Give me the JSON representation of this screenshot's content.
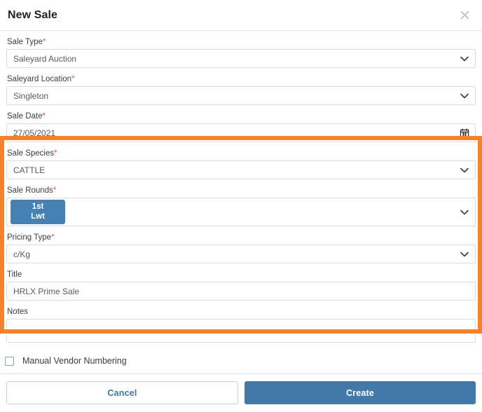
{
  "dialog": {
    "title": "New Sale",
    "close_icon": "close-icon"
  },
  "fields": {
    "sale_type": {
      "label": "Sale Type",
      "required": "*",
      "value": "Saleyard Auction",
      "icon": "chevron-down-icon"
    },
    "saleyard_location": {
      "label": "Saleyard Location",
      "required": "*",
      "value": "Singleton",
      "icon": "chevron-down-icon"
    },
    "sale_date": {
      "label": "Sale Date",
      "required": "*",
      "value": "27/05/2021",
      "icon": "calendar-icon"
    },
    "sale_species": {
      "label": "Sale Species",
      "required": "*",
      "value": "CATTLE",
      "icon": "chevron-down-icon"
    },
    "sale_rounds": {
      "label": "Sale Rounds",
      "required": "*",
      "chip_line1": "1st",
      "chip_line2": "Lwt",
      "icon": "chevron-down-icon"
    },
    "pricing_type": {
      "label": "Pricing Type",
      "required": "*",
      "value": "c/Kg",
      "icon": "chevron-down-icon"
    },
    "title_field": {
      "label": "Title",
      "value": "HRLX Prime Sale",
      "placeholder": ""
    },
    "notes": {
      "label": "Notes",
      "value": "",
      "placeholder": ""
    }
  },
  "manual_vendor_numbering": {
    "label": "Manual Vendor Numbering",
    "checked": false
  },
  "footer": {
    "cancel_label": "Cancel",
    "create_label": "Create"
  },
  "colors": {
    "highlight": "#f5812a",
    "primary": "#4179a8",
    "chip": "#4581b3",
    "required_asterisk": "#e8505b",
    "cancel_text": "#3f76a6"
  }
}
